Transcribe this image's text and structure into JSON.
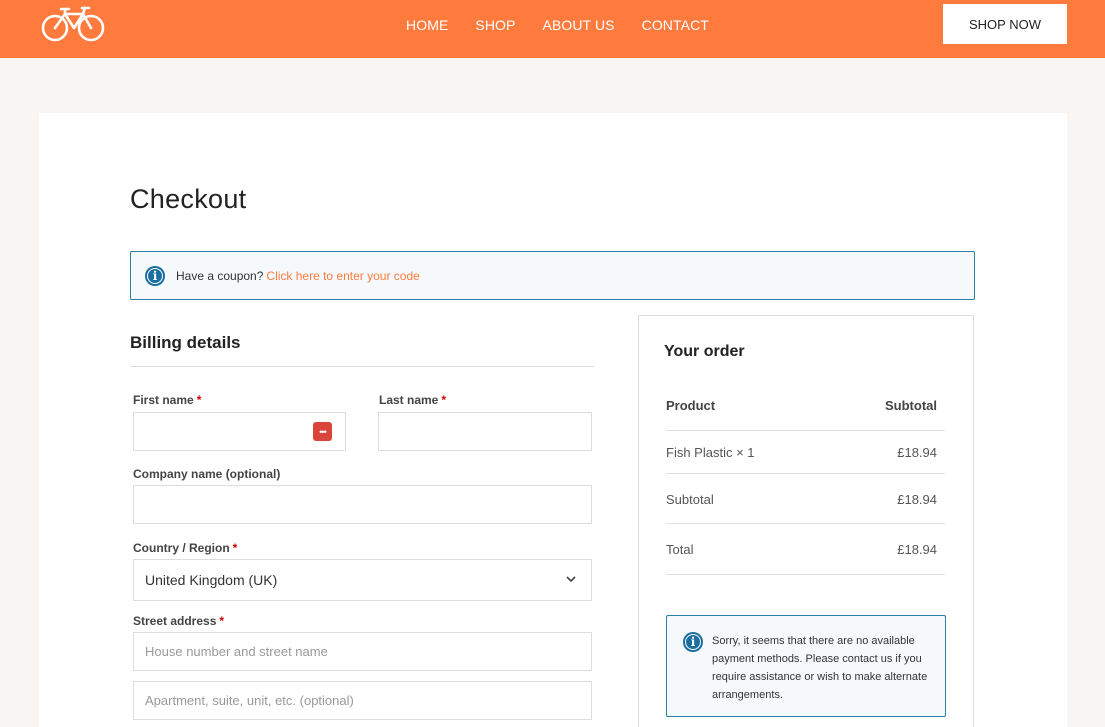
{
  "header": {
    "logo_icon": "bicycle-icon",
    "nav": [
      "HOME",
      "SHOP",
      "ABOUT US",
      "CONTACT"
    ],
    "cta_label": "SHOP NOW",
    "accent_color": "#ff7a3d"
  },
  "page": {
    "title": "Checkout",
    "coupon_text": "Have a coupon?",
    "coupon_link": "Click here to enter your code"
  },
  "billing": {
    "title": "Billing details",
    "first_name_label": "First name",
    "last_name_label": "Last name",
    "company_label": "Company name (optional)",
    "country_label": "Country / Region",
    "country_value": "United Kingdom (UK)",
    "street_label": "Street address",
    "street_placeholder": "House number and street name",
    "apartment_placeholder": "Apartment, suite, unit, etc. (optional)",
    "required_mark": "*",
    "password_manager_glyph": "•••"
  },
  "order": {
    "title": "Your order",
    "col_product": "Product",
    "col_subtotal": "Subtotal",
    "item_name": "Fish Plastic × 1",
    "item_price": "£18.94",
    "subtotal_label": "Subtotal",
    "subtotal_value": "£18.94",
    "total_label": "Total",
    "total_value": "£18.94",
    "payment_notice": "Sorry, it seems that there are no available payment methods. Please contact us if you require assistance or wish to make alternate arrangements."
  }
}
